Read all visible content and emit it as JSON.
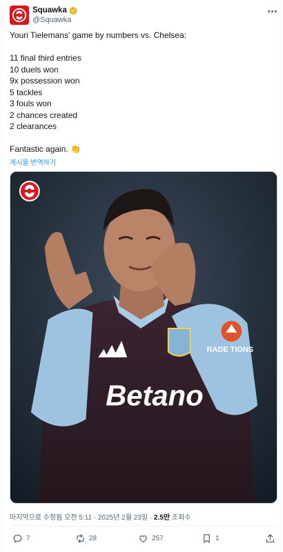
{
  "author": {
    "display_name": "Squawka",
    "handle": "@Squawka"
  },
  "tweet": {
    "lines": [
      "Youri Tielemans' game by numbers vs. Chelsea:",
      "",
      "11 final third entries",
      "10 duels won",
      "9x possession won",
      "5 tackles",
      "3 fouls won",
      "2 chances created",
      "2 clearances",
      "",
      "Fantastic again. 👏"
    ],
    "translate_link": "게시물 번역하기"
  },
  "media": {
    "sponsor_text": "Betano",
    "patch_text": "RADE TIONS"
  },
  "meta": {
    "timestamp": "마지막으로 수정됨 오전 5:11 · 2025년 2월 23일 · ",
    "views_count": "2.5만",
    "views_label": " 조회수"
  },
  "actions": {
    "replies": "7",
    "retweets": "28",
    "likes": "257",
    "bookmarks": "1"
  },
  "colors": {
    "brand_red": "#d7191f",
    "verified_gold": "#e2b719",
    "link_blue": "#1d9bf0",
    "secondary_text": "#536471"
  },
  "icons": [
    "squawka-logo-icon",
    "verified-badge-icon",
    "more-icon",
    "reply-icon",
    "retweet-icon",
    "like-icon",
    "bookmark-icon",
    "share-icon"
  ]
}
